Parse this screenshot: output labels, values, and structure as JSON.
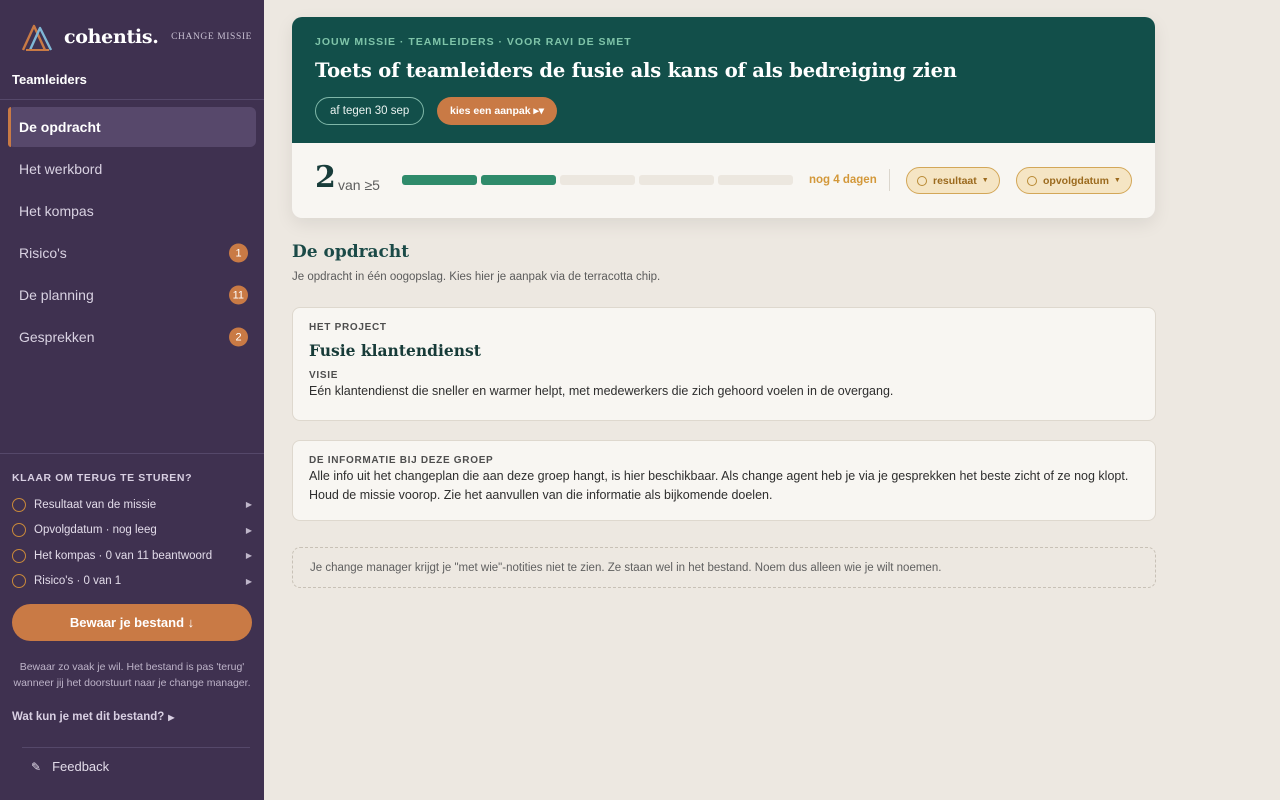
{
  "sidebar": {
    "brand_name": "cohentis.",
    "change_missie": "CHANGE MISSIE",
    "group_label": "Teamleiders",
    "nav": [
      {
        "label": "De opdracht",
        "badge": ""
      },
      {
        "label": "Het werkbord",
        "badge": ""
      },
      {
        "label": "Het kompas",
        "badge": ""
      },
      {
        "label": "Risico's",
        "badge": "1"
      },
      {
        "label": "De planning",
        "badge": "11"
      },
      {
        "label": "Gesprekken",
        "badge": "2"
      }
    ],
    "ready_title": "KLAAR OM TERUG TE STUREN?",
    "checklist": [
      {
        "label": "Resultaat van de missie"
      },
      {
        "label": "Opvolgdatum · nog leeg"
      },
      {
        "label": "Het kompas · 0 van 11 beantwoord"
      },
      {
        "label": "Risico's · 0 van 1"
      }
    ],
    "save_button": "Bewaar je bestand ↓",
    "save_note": "Bewaar zo vaak je wil. Het bestand is pas 'terug' wanneer jij het doorstuurt naar je change manager.",
    "what_link": "Wat kun je met dit bestand?",
    "feedback": "Feedback",
    "colors": {
      "sidebar_bg": "#3f3150",
      "accent": "#c97a45"
    }
  },
  "mission": {
    "eyebrow": "JOUW MISSIE · TEAMLEIDERS · VOOR RAVI DE SMET",
    "title": "Toets of teamleiders de fusie als kans of als bedreiging zien",
    "deadline_chip": "af tegen 30 sep",
    "approach_chip": "kies een aanpak ▸▾",
    "count": "2",
    "count_rest": "van ≥5",
    "progress": {
      "filled": 2,
      "total": 5
    },
    "days_left": "nog 4 dagen",
    "pill_result": "resultaat",
    "pill_date": "opvolgdatum",
    "colors": {
      "header_bg": "#124f4a",
      "progress_fill": "#2f8b6b"
    }
  },
  "section": {
    "title": "De opdracht",
    "subtitle": "Je opdracht in één oogopslag. Kies hier je aanpak via de terracotta chip."
  },
  "project_card": {
    "label": "HET PROJECT",
    "title": "Fusie klantendienst",
    "vision_label": "VISIE",
    "vision_text": "Eén klantendienst die sneller en warmer helpt, met medewerkers die zich gehoord voelen in de overgang."
  },
  "info_card": {
    "label": "DE INFORMATIE BIJ DEZE GROEP",
    "text": "Alle info uit het changeplan die aan deze groep hangt, is hier beschikbaar. Als change agent heb je via je gesprekken het beste zicht of ze nog klopt. Houd de missie voorop. Zie het aanvullen van die informatie als bijkomende doelen."
  },
  "note": {
    "text": "Je change manager krijgt je \"met wie\"-notities niet te zien. Ze staan wel in het bestand. Noem dus alleen wie je wilt noemen."
  }
}
